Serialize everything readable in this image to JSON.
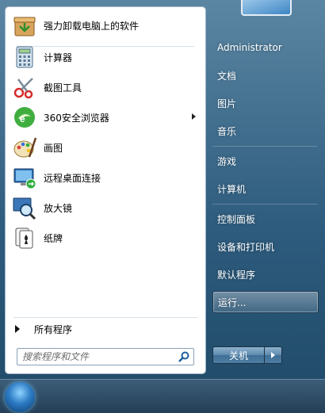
{
  "programs": [
    {
      "label": "强力卸载电脑上的软件",
      "icon": "uninstall-icon",
      "has_submenu": false
    },
    {
      "label": "计算器",
      "icon": "calculator-icon",
      "has_submenu": false
    },
    {
      "label": "截图工具",
      "icon": "scissors-icon",
      "has_submenu": false
    },
    {
      "label": "360安全浏览器",
      "icon": "browser-360-icon",
      "has_submenu": true
    },
    {
      "label": "画图",
      "icon": "paint-icon",
      "has_submenu": false
    },
    {
      "label": "远程桌面连接",
      "icon": "remote-desktop-icon",
      "has_submenu": false
    },
    {
      "label": "放大镜",
      "icon": "magnifier-icon",
      "has_submenu": false
    },
    {
      "label": "纸牌",
      "icon": "solitaire-icon",
      "has_submenu": false
    }
  ],
  "all_programs_label": "所有程序",
  "search": {
    "placeholder": "搜索程序和文件"
  },
  "right_items": [
    {
      "label": "Administrator"
    },
    {
      "label": "文档"
    },
    {
      "label": "图片"
    },
    {
      "label": "音乐"
    },
    {
      "label": "游戏"
    },
    {
      "label": "计算机"
    },
    {
      "label": "控制面板"
    },
    {
      "label": "设备和打印机"
    },
    {
      "label": "默认程序"
    },
    {
      "label": "运行..."
    }
  ],
  "shutdown_label": "关机",
  "colors": {
    "accent": "#2e5c7e",
    "hover_border": "#1c3850"
  }
}
